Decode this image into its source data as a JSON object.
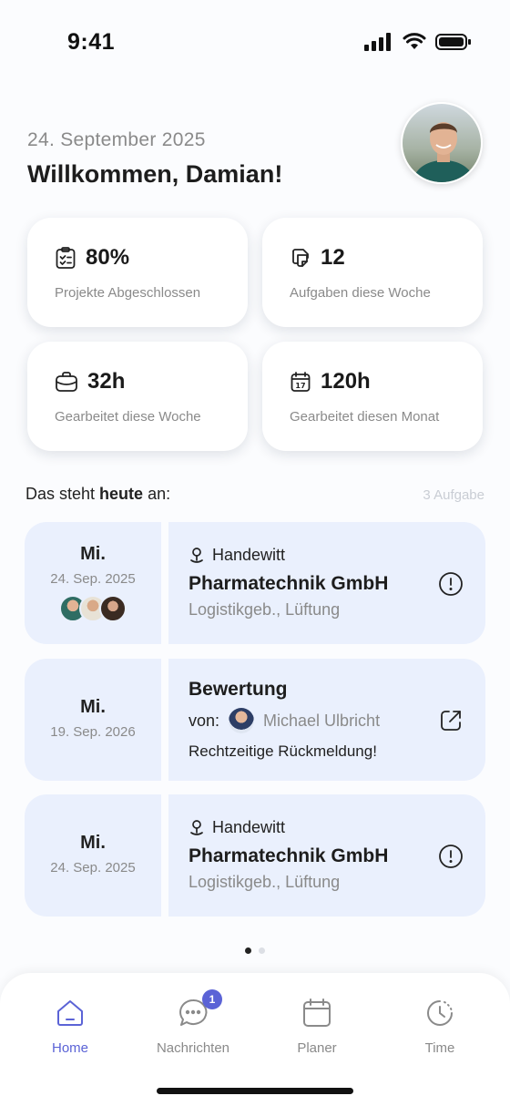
{
  "status": {
    "time": "9:41"
  },
  "header": {
    "date": "24. September 2025",
    "welcome": "Willkommen, Damian!"
  },
  "stats": [
    {
      "icon": "clipboard-check-icon",
      "value": "80%",
      "label": "Projekte Abgeschlossen"
    },
    {
      "icon": "notes-icon",
      "value": "12",
      "label": "Aufgaben diese Woche"
    },
    {
      "icon": "briefcase-icon",
      "value": "32h",
      "label": "Gearbeitet diese Woche"
    },
    {
      "icon": "calendar-17-icon",
      "value": "120h",
      "label": "Gearbeitet diesen Monat"
    }
  ],
  "today": {
    "prefix": "Das steht ",
    "bold": "heute",
    "suffix": " an:",
    "count": "3 Aufgabe"
  },
  "tasks": [
    {
      "day": "Mi.",
      "date": "24. Sep. 2025",
      "location": "Handewitt",
      "company": "Pharmatechnik GmbH",
      "detail": "Logistikgeb., Lüftung"
    },
    {
      "day": "Mi.",
      "date": "19. Sep. 2026",
      "title": "Bewertung",
      "from_label": "von:",
      "from_name": "Michael Ulbricht",
      "message": "Rechtzeitige Rückmeldung!"
    },
    {
      "day": "Mi.",
      "date": "24. Sep. 2025",
      "location": "Handewitt",
      "company": "Pharmatechnik GmbH",
      "detail": "Logistikgeb., Lüftung"
    }
  ],
  "nav": {
    "home": "Home",
    "messages": "Nachrichten",
    "messages_badge": "1",
    "planner": "Planer",
    "time": "Time"
  },
  "colors": {
    "accent": "#5b63d6",
    "card_bg": "#eaf0fd"
  }
}
